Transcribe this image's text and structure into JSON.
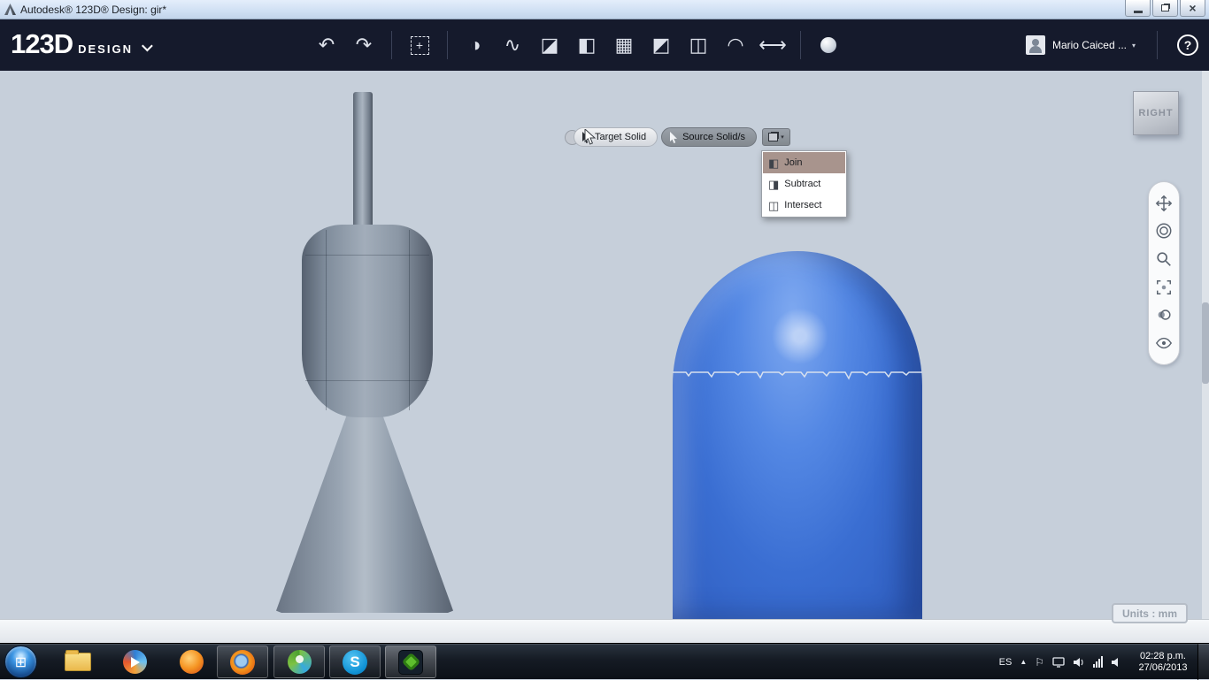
{
  "titlebar": {
    "title": "Autodesk® 123D® Design: gir*"
  },
  "header": {
    "logo_main": "123D",
    "logo_sub": "DESIGN",
    "user_name": "Mario Caiced ...",
    "help_label": "?"
  },
  "glyphs": {
    "undo": "↶",
    "redo": "↷",
    "transform_plus": "+",
    "split_sphere": "◑",
    "spline": "∿",
    "chamfer_cube": "◪",
    "extrude_cube": "◧",
    "pattern_grid": "▦",
    "snap_cube": "◩",
    "group_cubes": "◫",
    "magnet": "◠",
    "measure": "⟷",
    "user_dropdown": "▾",
    "combine_caret": "▾",
    "tray_expand": "▲",
    "tray_flag": "⚐",
    "window_close": "×",
    "join_icon": "◧",
    "subtract_icon": "◨",
    "intersect_icon": "◫",
    "start_grid": "⊞"
  },
  "selection_bar": {
    "target_label": "Target Solid",
    "source_label": "Source Solid/s"
  },
  "combine_menu": {
    "items": [
      {
        "label": "Join",
        "selected": true
      },
      {
        "label": "Subtract",
        "selected": false
      },
      {
        "label": "Intersect",
        "selected": false
      }
    ]
  },
  "viewcube": {
    "face": "RIGHT"
  },
  "status_bar": {
    "units_label": "Units : mm"
  },
  "taskbar": {
    "skype_letter": "S",
    "tray": {
      "language": "ES",
      "time": "02:28 p.m.",
      "date": "27/06/2013"
    }
  },
  "colors": {
    "accent_blue": "#3f74d8",
    "header_bg": "#151a2c",
    "viewport_bg": "#c6cfda",
    "menu_highlight": "#a8948d"
  }
}
